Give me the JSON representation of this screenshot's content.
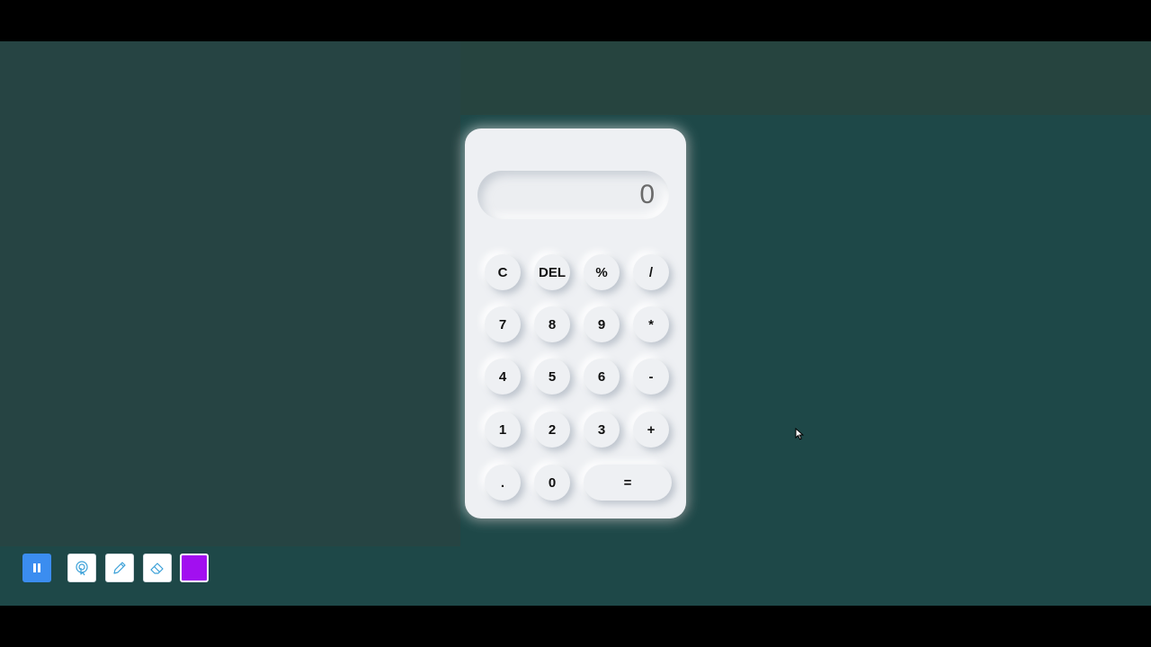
{
  "calculator": {
    "display_value": "0",
    "buttons": [
      {
        "label": "C"
      },
      {
        "label": "DEL"
      },
      {
        "label": "%"
      },
      {
        "label": "/"
      },
      {
        "label": "7"
      },
      {
        "label": "8"
      },
      {
        "label": "9"
      },
      {
        "label": "*"
      },
      {
        "label": "4"
      },
      {
        "label": "5"
      },
      {
        "label": "6"
      },
      {
        "label": "-"
      },
      {
        "label": "1"
      },
      {
        "label": "2"
      },
      {
        "label": "3"
      },
      {
        "label": "+"
      },
      {
        "label": "."
      },
      {
        "label": "0"
      },
      {
        "label": "="
      }
    ]
  },
  "toolbar": {
    "pause_icon": "pause-icon",
    "laser_icon": "laser-pointer-icon",
    "pen_icon": "pen-icon",
    "eraser_icon": "eraser-icon",
    "selected_color": "#a20ff0"
  },
  "colors": {
    "background": "#1e4848",
    "calculator_body": "#eef0f3",
    "accent": "#3b8df0"
  }
}
